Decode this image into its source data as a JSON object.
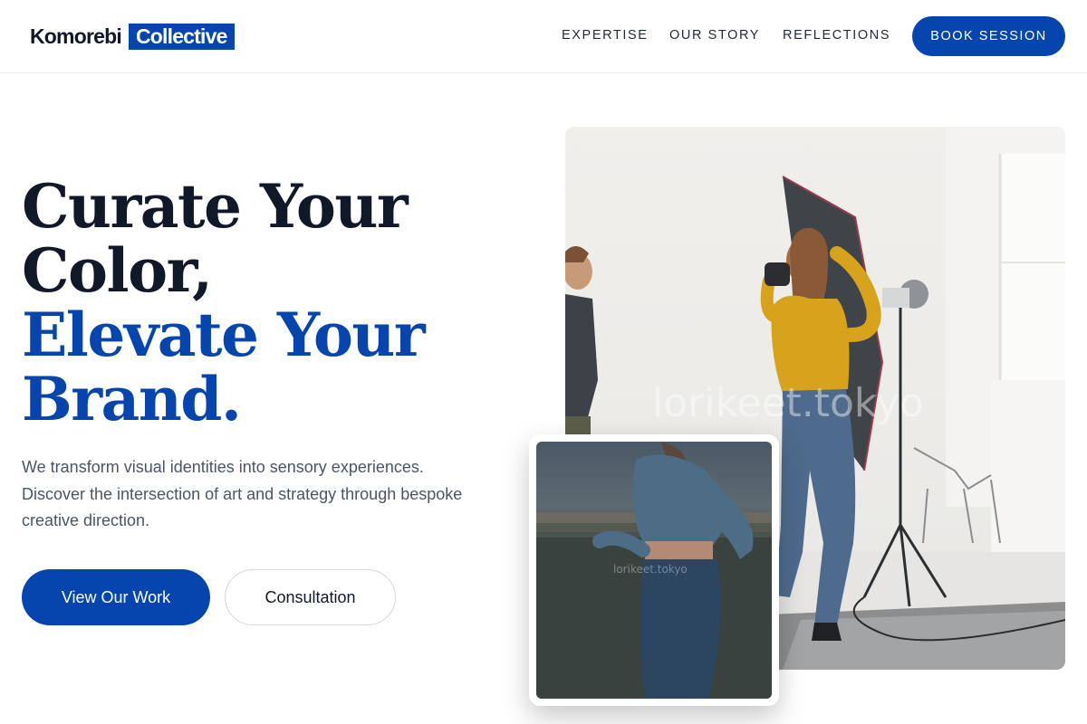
{
  "brand": {
    "name_part1": "Komorebi",
    "name_part2": "Collective"
  },
  "nav": {
    "items": [
      "EXPERTISE",
      "OUR STORY",
      "REFLECTIONS"
    ],
    "cta": "BOOK SESSION"
  },
  "hero": {
    "headline_line1": "Curate Your",
    "headline_line2": "Color,",
    "headline_line3": "Elevate Your",
    "headline_line4": "Brand.",
    "subtext": "We transform visual identities into sensory experiences. Discover the intersection of art and strategy through bespoke creative direction.",
    "primary_button": "View Our Work",
    "secondary_button": "Consultation"
  },
  "images": {
    "main_watermark": "lorikeet.tokyo",
    "inset_watermark": "lorikeet.tokyo"
  },
  "colors": {
    "accent": "#0645ad",
    "text_dark": "#111827",
    "text_muted": "#4b5563"
  }
}
